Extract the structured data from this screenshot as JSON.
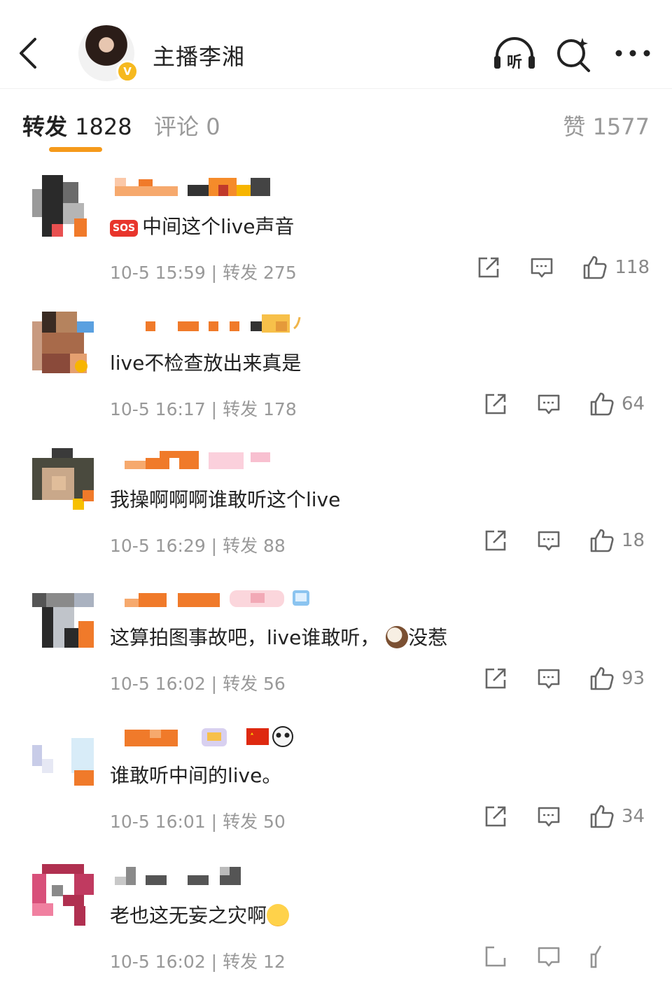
{
  "header": {
    "title": "主播李湘",
    "listen_label": "听",
    "verified_badge": "V"
  },
  "tabs": {
    "repost_label": "转发",
    "repost_count": "1828",
    "comment_label": "评论",
    "comment_count": "0",
    "like_label": "赞",
    "like_count": "1577",
    "accent_color": "#f59a1b"
  },
  "reposts": [
    {
      "content": "中间这个live声音",
      "badge": "SOS",
      "time": "10-5 15:59",
      "repost_label": "转发",
      "repost_count": "275",
      "likes": "118"
    },
    {
      "content": "live不检查放出来真是",
      "time": "10-5 16:17",
      "repost_label": "转发",
      "repost_count": "178",
      "likes": "64"
    },
    {
      "content": "我操啊啊啊谁敢听这个live",
      "time": "10-5 16:29",
      "repost_label": "转发",
      "repost_count": "88",
      "likes": "18"
    },
    {
      "content_a": "这算拍图事故吧，live谁敢听，",
      "content_b": "没惹",
      "time": "10-5 16:02",
      "repost_label": "转发",
      "repost_count": "56",
      "likes": "93"
    },
    {
      "content": "谁敢听中间的live。",
      "time": "10-5 16:01",
      "repost_label": "转发",
      "repost_count": "50",
      "likes": "34"
    },
    {
      "content": "老也这无妄之灾啊",
      "time": "10-5 16:02",
      "repost_label": "转发",
      "repost_count": "12",
      "likes": ""
    }
  ],
  "icons": {
    "back": "back-arrow-icon",
    "listen": "headphones-icon",
    "search": "sparkle-search-icon",
    "more": "more-dots-icon",
    "share": "share-icon",
    "comment": "comment-icon",
    "like": "thumbs-up-icon"
  }
}
